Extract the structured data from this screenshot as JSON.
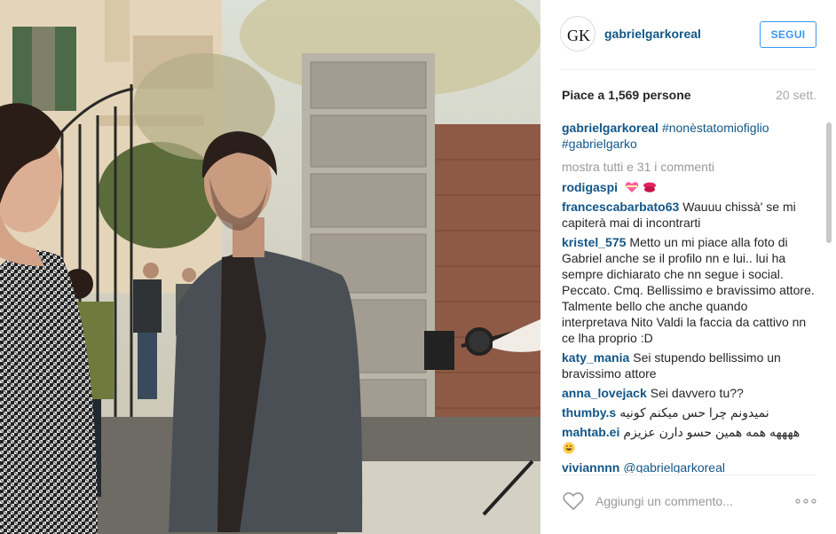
{
  "post": {
    "username": "gabrielgarkoreal",
    "avatar_monogram": "GK",
    "follow_label": "SEGUI",
    "likes_text": "Piace a 1,569 persone",
    "date_text": "20 sett."
  },
  "caption": {
    "user": "gabrielgarkoreal",
    "tag1": "#nonèstatomiofiglio",
    "tag2": "#gabrielgarko"
  },
  "show_all_text": "mostra tutti e 31 i commenti",
  "comments": [
    {
      "user": "rodigaspi",
      "text": "",
      "emoji": [
        "heart-with-ribbon-emoji",
        "kiss-mark-emoji"
      ]
    },
    {
      "user": "francescabarbato63",
      "text": "Wauuu chissà' se mi capiterà mai di incontrarti"
    },
    {
      "user": "kristel_575",
      "text": "Metto un mi piace alla foto di Gabriel anche se il profilo nn e lui.. lui ha sempre dichiarato che nn segue i social. Peccato. Cmq. Bellissimo e bravissimo attore. Talmente bello che anche quando interpretava Nito Valdi la faccia da cattivo nn ce lha proprio :D"
    },
    {
      "user": "katy_mania",
      "text": "Sei stupendo bellissimo un bravissimo attore"
    },
    {
      "user": "anna_lovejack",
      "text": "Sei davvero tu??"
    },
    {
      "user": "thumby.s",
      "text": "نمیدونم چرا حس میکنم کونیه"
    },
    {
      "user": "mahtab.ei",
      "text": "ههههه همه همین حسو دارن عزیزم",
      "emoji": [
        "grinning-face-emoji"
      ]
    },
    {
      "user": "viviannnn",
      "text": "@gabrielgarkoreal"
    }
  ],
  "comment_box": {
    "placeholder": "Aggiungi un commento..."
  },
  "icons": {
    "like": "heart-outline-icon",
    "more": "more-options-icon"
  },
  "colors": {
    "link": "#125688",
    "follow": "#3897f0",
    "muted": "#999999"
  }
}
